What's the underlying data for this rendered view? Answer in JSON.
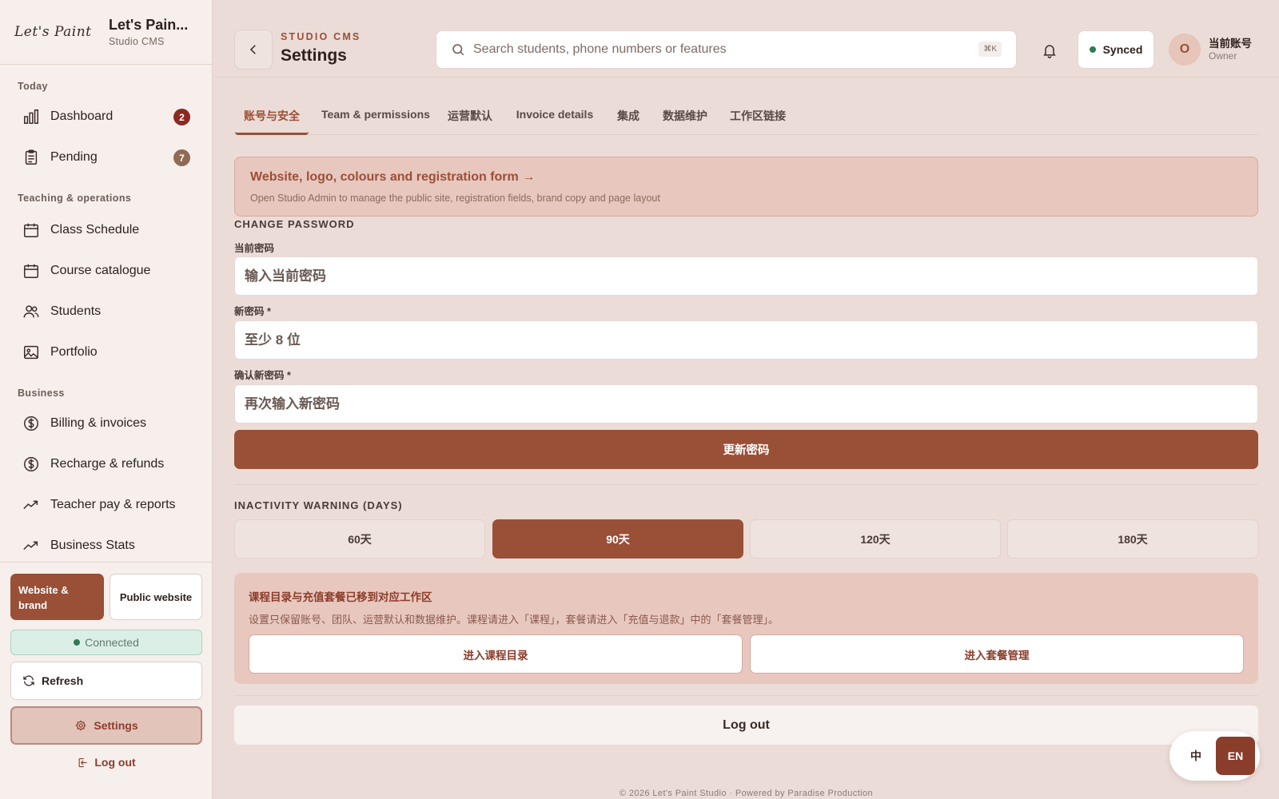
{
  "brand": {
    "script": "Let's Paint",
    "name": "Let's Pain...",
    "sub": "Studio CMS"
  },
  "sidebar": {
    "sections": [
      {
        "label": "Today"
      },
      {
        "label": "Teaching & operations"
      },
      {
        "label": "Business"
      }
    ],
    "items": [
      {
        "label": "Dashboard",
        "icon": "bar-chart-icon",
        "badge": "2"
      },
      {
        "label": "Pending",
        "icon": "clipboard-icon",
        "badge": "7"
      },
      {
        "label": "Class Schedule",
        "icon": "calendar-icon"
      },
      {
        "label": "Course catalogue",
        "icon": "calendar-icon"
      },
      {
        "label": "Students",
        "icon": "users-icon"
      },
      {
        "label": "Portfolio",
        "icon": "image-icon"
      },
      {
        "label": "Billing & invoices",
        "icon": "dollar-circle-icon"
      },
      {
        "label": "Recharge & refunds",
        "icon": "dollar-circle-icon"
      },
      {
        "label": "Teacher pay & reports",
        "icon": "trend-icon"
      },
      {
        "label": "Business Stats",
        "icon": "trend-icon"
      }
    ],
    "bottom": {
      "website_brand": "Website & brand",
      "public_website": "Public website",
      "connected": "Connected",
      "refresh": "Refresh",
      "settings": "Settings",
      "logout": "Log out"
    }
  },
  "header": {
    "kicker": "STUDIO CMS",
    "title": "Settings",
    "search_placeholder": "Search students, phone numbers or features",
    "shortcut": "⌘K",
    "sync_status": "Synced",
    "avatar_initial": "O",
    "account_name": "当前账号",
    "account_role": "Owner"
  },
  "tabs": [
    "账号与安全",
    "Team & permissions",
    "运营默认",
    "Invoice details",
    "集成",
    "数据维护",
    "工作区链接"
  ],
  "active_tab": "账号与安全",
  "banner": {
    "title": "Website, logo, colours and registration form →",
    "subtitle": "Open Studio Admin to manage the public site, registration fields, brand copy and page layout"
  },
  "password": {
    "section": "CHANGE PASSWORD",
    "current_label": "当前密码",
    "current_placeholder": "输入当前密码",
    "new_label": "新密码 *",
    "new_placeholder": "至少 8 位",
    "confirm_label": "确认新密码 *",
    "confirm_placeholder": "再次输入新密码",
    "submit": "更新密码"
  },
  "inactivity": {
    "section": "INACTIVITY WARNING (DAYS)",
    "options": [
      "60天",
      "90天",
      "120天",
      "180天"
    ],
    "selected": "90天"
  },
  "notice": {
    "title": "课程目录与充值套餐已移到对应工作区",
    "text": "设置只保留账号、团队、运营默认和数据维护。课程请进入「课程」，套餐请进入「充值与退款」中的「套餐管理」。",
    "btn_courses": "进入课程目录",
    "btn_packages": "进入套餐管理"
  },
  "logout": "Log out",
  "footer": "© 2026 Let's Paint Studio · Powered by Paradise Production",
  "language": {
    "zh": "中",
    "en": "EN",
    "active": "EN"
  },
  "colors": {
    "accent": "#9a4f37",
    "background": "#ecdcd7",
    "sidebar": "#f6efec",
    "badge_red": "#8c2a22",
    "synced_green": "#2f7a57"
  }
}
